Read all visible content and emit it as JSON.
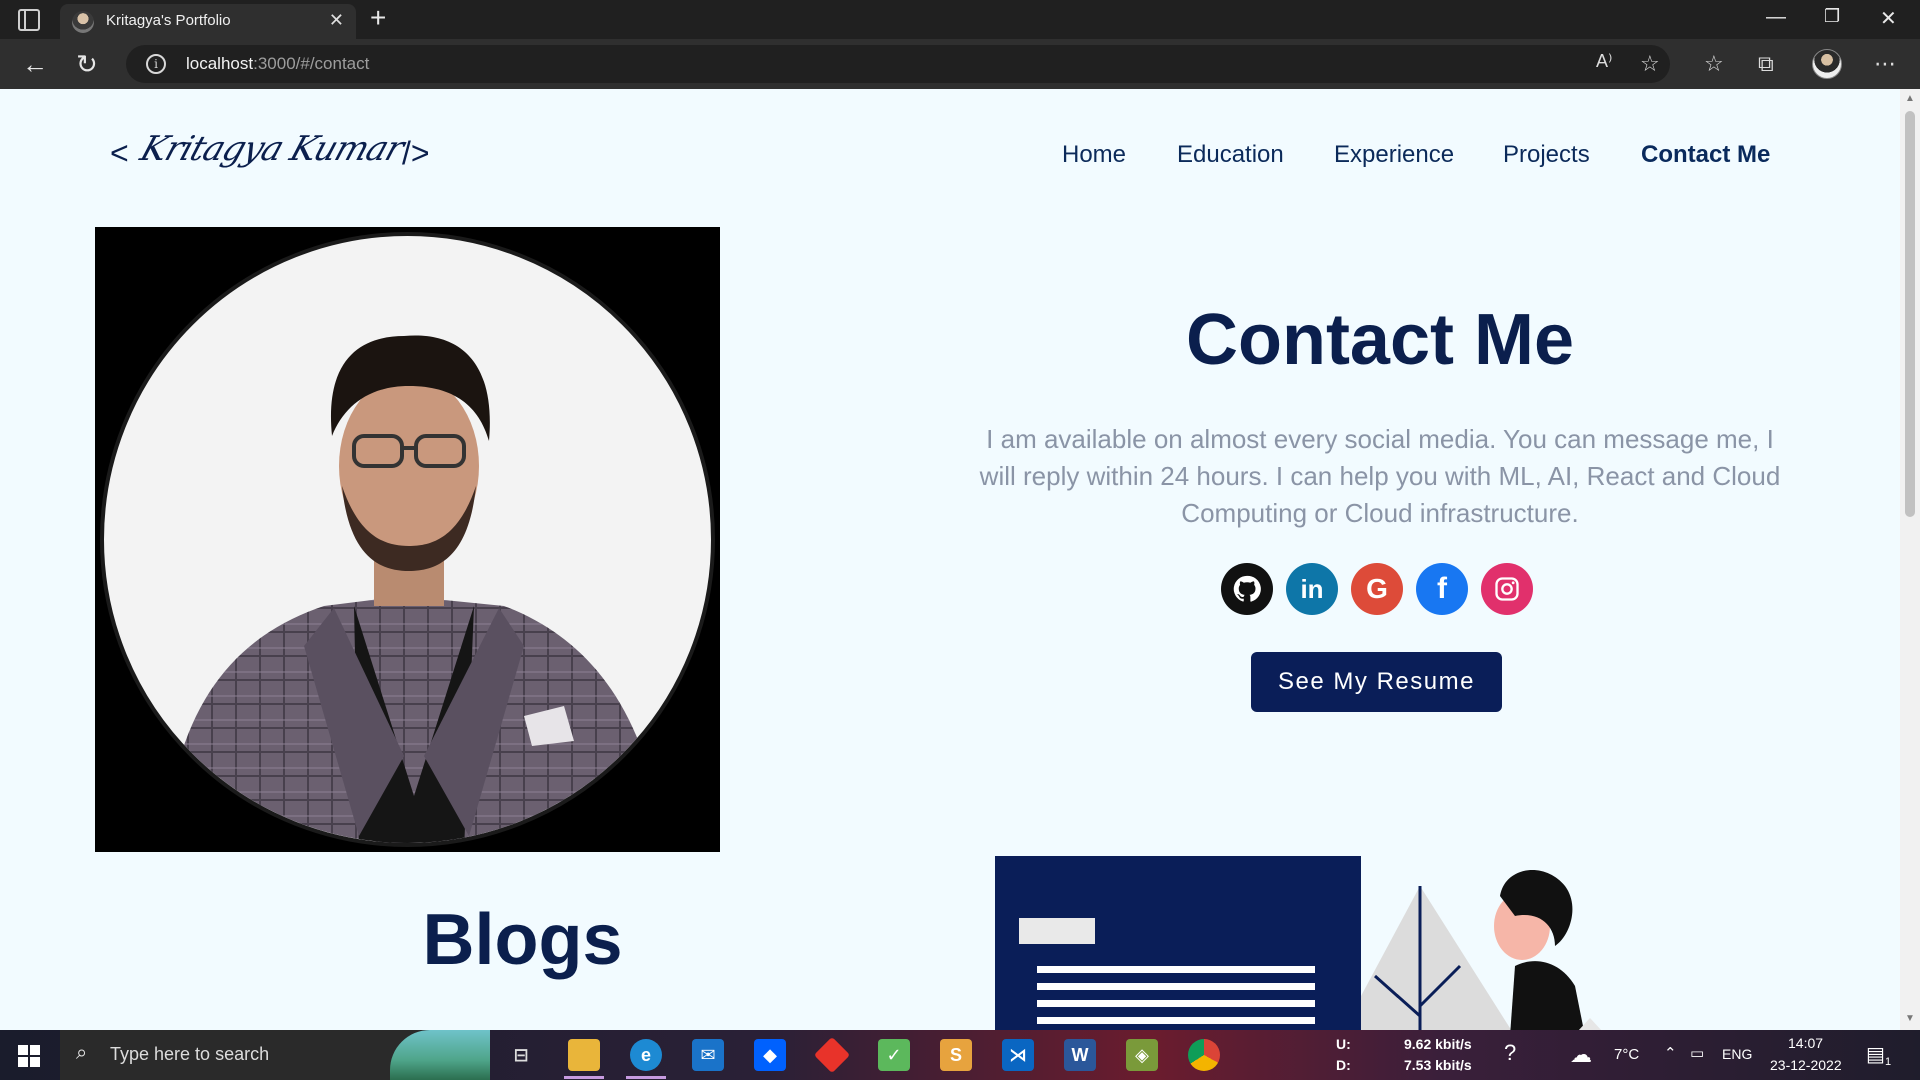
{
  "browser": {
    "tab_title": "Kritagya's Portfolio",
    "url_host": "localhost",
    "url_path": ":3000/#/contact"
  },
  "site": {
    "logo_open": "<",
    "logo_signature": "Kritagya Kumar",
    "logo_close": "/>",
    "nav": [
      "Home",
      "Education",
      "Experience",
      "Projects",
      "Contact Me"
    ],
    "active_nav": "Contact Me"
  },
  "contact": {
    "title": "Contact Me",
    "description": "I am available on almost every social media. You can message me, I will reply within 24 hours. I can help you with ML, AI, React and Cloud Computing or Cloud infrastructure.",
    "socials": [
      {
        "name": "github",
        "color": "#111111"
      },
      {
        "name": "linkedin",
        "color": "#0e76a8"
      },
      {
        "name": "google",
        "color": "#dd4b39"
      },
      {
        "name": "facebook",
        "color": "#1877f2"
      },
      {
        "name": "instagram",
        "color": "#e1306c"
      }
    ],
    "resume_button": "See My Resume"
  },
  "blogs": {
    "title": "Blogs"
  },
  "taskbar": {
    "search_placeholder": "Type here to search",
    "upload_label": "U:",
    "download_label": "D:",
    "upload_speed": "9.62 kbit/s",
    "download_speed": "7.53 kbit/s",
    "temperature": "7°C",
    "language": "ENG",
    "time": "14:07",
    "date": "23-12-2022",
    "notification_count": "1"
  },
  "colors": {
    "page_bg": "#f2fbff",
    "navy": "#0b1f4d",
    "button": "#0a1e58"
  }
}
